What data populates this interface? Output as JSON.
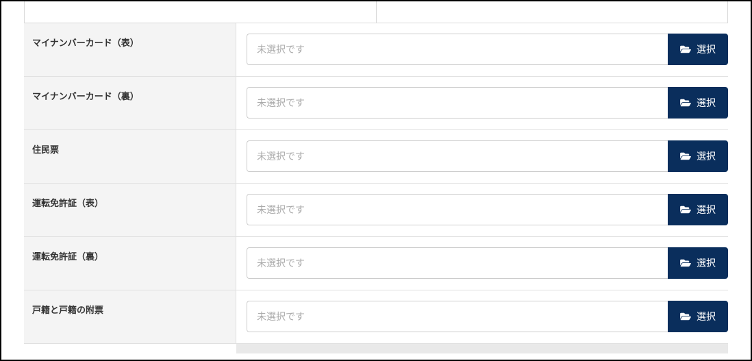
{
  "placeholder": "未選択です",
  "selectLabel": "選択",
  "rows": [
    {
      "label": "マイナンバーカード（表）"
    },
    {
      "label": "マイナンバーカード（裏）"
    },
    {
      "label": "住民票"
    },
    {
      "label": "運転免許証（表）"
    },
    {
      "label": "運転免許証（裏）"
    },
    {
      "label": "戸籍と戸籍の附票"
    }
  ]
}
